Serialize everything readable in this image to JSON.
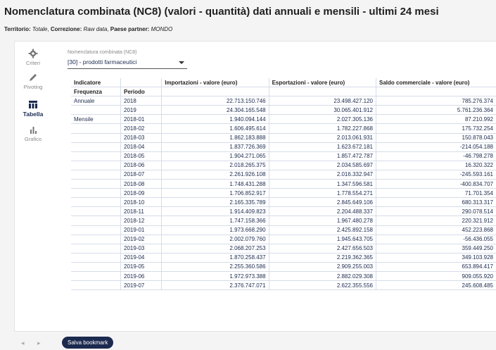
{
  "title": "Nomenclatura combinata (NC8) (valori - quantità) dati annuali e mensili - ultimi 24 mesi",
  "subtitle": {
    "territorio_label": "Territorio:",
    "territorio_value": "Totale",
    "correzione_label": "Correzione:",
    "correzione_value": "Raw data",
    "paese_label": "Paese partner:",
    "paese_value": "MONDO"
  },
  "sidebar": {
    "criteri": "Criteri",
    "pivoting": "Pivoting",
    "tabella": "Tabella",
    "grafico": "Grafico"
  },
  "filter": {
    "label": "Nomenclatura combinata (NC8)",
    "value": "[30] - prodotti farmaceutici"
  },
  "table": {
    "indicatore": "Indicatore",
    "frequenza": "Frequenza",
    "periodo": "Periodo",
    "columns": [
      "Importazioni - valore (euro)",
      "Esportazioni - valore (euro)",
      "Saldo commerciale - valore (euro)"
    ],
    "rows": [
      {
        "freq": "Annuale",
        "period": "2018",
        "imp": "22.713.150.746",
        "exp": "23.498.427.120",
        "saldo": "785.276.374"
      },
      {
        "freq": "",
        "period": "2019",
        "imp": "24.304.165.548",
        "exp": "30.065.401.912",
        "saldo": "5.761.236.364"
      },
      {
        "freq": "Mensile",
        "period": "2018-01",
        "imp": "1.940.094.144",
        "exp": "2.027.305.136",
        "saldo": "87.210.992"
      },
      {
        "freq": "",
        "period": "2018-02",
        "imp": "1.606.495.614",
        "exp": "1.782.227.868",
        "saldo": "175.732.254"
      },
      {
        "freq": "",
        "period": "2018-03",
        "imp": "1.862.183.888",
        "exp": "2.013.061.931",
        "saldo": "150.878.043"
      },
      {
        "freq": "",
        "period": "2018-04",
        "imp": "1.837.726.369",
        "exp": "1.623.672.181",
        "saldo": "-214.054.188"
      },
      {
        "freq": "",
        "period": "2018-05",
        "imp": "1.904.271.065",
        "exp": "1.857.472.787",
        "saldo": "-46.798.278"
      },
      {
        "freq": "",
        "period": "2018-06",
        "imp": "2.018.265.375",
        "exp": "2.034.585.697",
        "saldo": "16.320.322"
      },
      {
        "freq": "",
        "period": "2018-07",
        "imp": "2.261.926.108",
        "exp": "2.016.332.947",
        "saldo": "-245.593.161"
      },
      {
        "freq": "",
        "period": "2018-08",
        "imp": "1.748.431.288",
        "exp": "1.347.596.581",
        "saldo": "-400.834.707"
      },
      {
        "freq": "",
        "period": "2018-09",
        "imp": "1.706.852.917",
        "exp": "1.778.554.271",
        "saldo": "71.701.354"
      },
      {
        "freq": "",
        "period": "2018-10",
        "imp": "2.165.335.789",
        "exp": "2.845.649.106",
        "saldo": "680.313.317"
      },
      {
        "freq": "",
        "period": "2018-11",
        "imp": "1.914.409.823",
        "exp": "2.204.488.337",
        "saldo": "290.078.514"
      },
      {
        "freq": "",
        "period": "2018-12",
        "imp": "1.747.158.366",
        "exp": "1.967.480.278",
        "saldo": "220.321.912"
      },
      {
        "freq": "",
        "period": "2019-01",
        "imp": "1.973.668.290",
        "exp": "2.425.892.158",
        "saldo": "452.223.868"
      },
      {
        "freq": "",
        "period": "2019-02",
        "imp": "2.002.079.760",
        "exp": "1.945.643.705",
        "saldo": "-56.436.055"
      },
      {
        "freq": "",
        "period": "2019-03",
        "imp": "2.068.207.253",
        "exp": "2.427.656.503",
        "saldo": "359.449.250"
      },
      {
        "freq": "",
        "period": "2019-04",
        "imp": "1.870.258.437",
        "exp": "2.219.362.365",
        "saldo": "349.103.928"
      },
      {
        "freq": "",
        "period": "2019-05",
        "imp": "2.255.360.586",
        "exp": "2.909.255.003",
        "saldo": "653.894.417"
      },
      {
        "freq": "",
        "period": "2019-06",
        "imp": "1.972.973.388",
        "exp": "2.882.029.308",
        "saldo": "909.055.920"
      },
      {
        "freq": "",
        "period": "2019-07",
        "imp": "2.376.747.071",
        "exp": "2.622.355.556",
        "saldo": "245.608.485"
      }
    ]
  },
  "footer": {
    "prev": "◂",
    "next": "▸",
    "bookmark": "Salva bookmark"
  }
}
